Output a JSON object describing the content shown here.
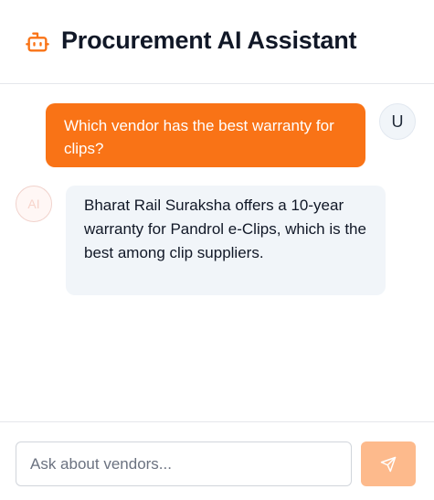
{
  "header": {
    "title": "Procurement AI Assistant",
    "icon": "bot-icon",
    "accent_color": "#f97316"
  },
  "messages": [
    {
      "role": "user",
      "avatar_label": "U",
      "text": "Which vendor has the best warranty for clips?"
    },
    {
      "role": "assistant",
      "avatar_label": "AI",
      "text": "Bharat Rail Suraksha offers a 10-year warranty for Pandrol e-Clips, which is the best among clip suppliers."
    }
  ],
  "composer": {
    "placeholder": "Ask about vendors...",
    "value": "",
    "send_icon": "send-icon"
  }
}
